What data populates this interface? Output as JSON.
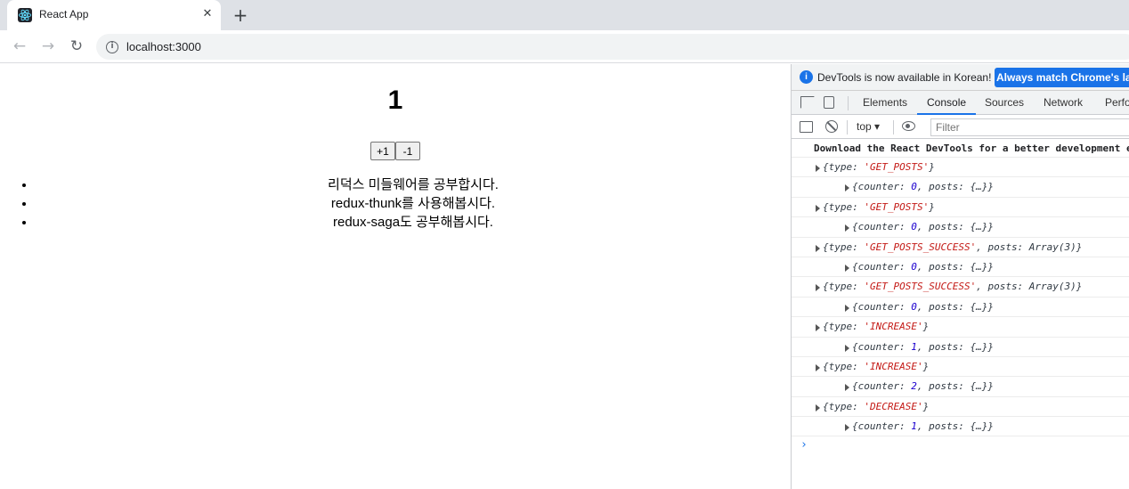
{
  "browser": {
    "tab_title": "React App",
    "tab_close_glyph": "✕",
    "new_tab_glyph": "+",
    "nav_back_glyph": "←",
    "nav_forward_glyph": "→",
    "nav_reload_glyph": "↻",
    "url": "localhost:3000"
  },
  "page": {
    "counter_value": "1",
    "increase_label": "+1",
    "decrease_label": "-1",
    "todos": [
      "리덕스 미들웨어를 공부합시다.",
      "redux-thunk를 사용해봅시다.",
      "redux-saga도 공부해봅시다."
    ]
  },
  "devtools": {
    "info_text": "DevTools is now available in Korean!",
    "info_button": "Always match Chrome's language",
    "tabs": [
      "Elements",
      "Console",
      "Sources",
      "Network",
      "Performance"
    ],
    "active_tab": "Console",
    "context": "top",
    "filter_placeholder": "Filter",
    "first_message": "Download the React DevTools for a better development experience",
    "logs": [
      {
        "kind": "action",
        "type": "GET_POSTS",
        "extra": ""
      },
      {
        "kind": "state",
        "counter": "0"
      },
      {
        "kind": "action",
        "type": "GET_POSTS",
        "extra": ""
      },
      {
        "kind": "state",
        "counter": "0"
      },
      {
        "kind": "action",
        "type": "GET_POSTS_SUCCESS",
        "extra": "posts: Array(3)"
      },
      {
        "kind": "state",
        "counter": "0"
      },
      {
        "kind": "action",
        "type": "GET_POSTS_SUCCESS",
        "extra": "posts: Array(3)"
      },
      {
        "kind": "state",
        "counter": "0"
      },
      {
        "kind": "action",
        "type": "INCREASE",
        "extra": ""
      },
      {
        "kind": "state",
        "counter": "1"
      },
      {
        "kind": "action",
        "type": "INCREASE",
        "extra": ""
      },
      {
        "kind": "state",
        "counter": "2"
      },
      {
        "kind": "action",
        "type": "DECREASE",
        "extra": ""
      },
      {
        "kind": "state",
        "counter": "1"
      }
    ],
    "prompt_glyph": "›",
    "accent_color": "#1a73e8"
  }
}
